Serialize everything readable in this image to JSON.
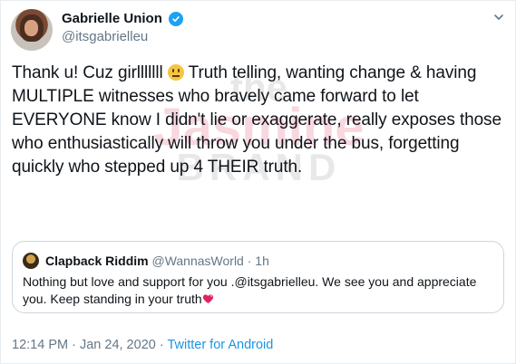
{
  "author": {
    "display_name": "Gabrielle Union",
    "handle": "@itsgabrielleu",
    "verified": true
  },
  "tweet": {
    "text_before_emoji": "Thank u! Cuz girlllllll ",
    "text_after_emoji": " Truth telling, wanting change & having MULTIPLE witnesses who bravely came forward to let EVERYONE know I didn't lie or exaggerate, really exposes those who enthusiastically will throw you under the bus, forgetting quickly who stepped up 4 THEIR truth.",
    "emoji": "grimacing-face-icon"
  },
  "quoted_tweet": {
    "display_name": "Clapback Riddim",
    "handle": "@WannasWorld",
    "separator": " · ",
    "age": "1h",
    "text": "Nothing but love and support for you .@itsgabrielleu. We see you and appreciate you. Keep standing in your truth",
    "emoji": "heart-icon"
  },
  "footer": {
    "time": "12:14 PM",
    "separator": " · ",
    "date": "Jan 24, 2020",
    "source": "Twitter for Android"
  },
  "watermark": {
    "line1": "the",
    "line2": "Jasmine",
    "line3": "BRAND"
  },
  "colors": {
    "verified": "#1da1f2",
    "link": "#1b95e0",
    "secondary_text": "#657786",
    "border": "#ccd6dd"
  }
}
